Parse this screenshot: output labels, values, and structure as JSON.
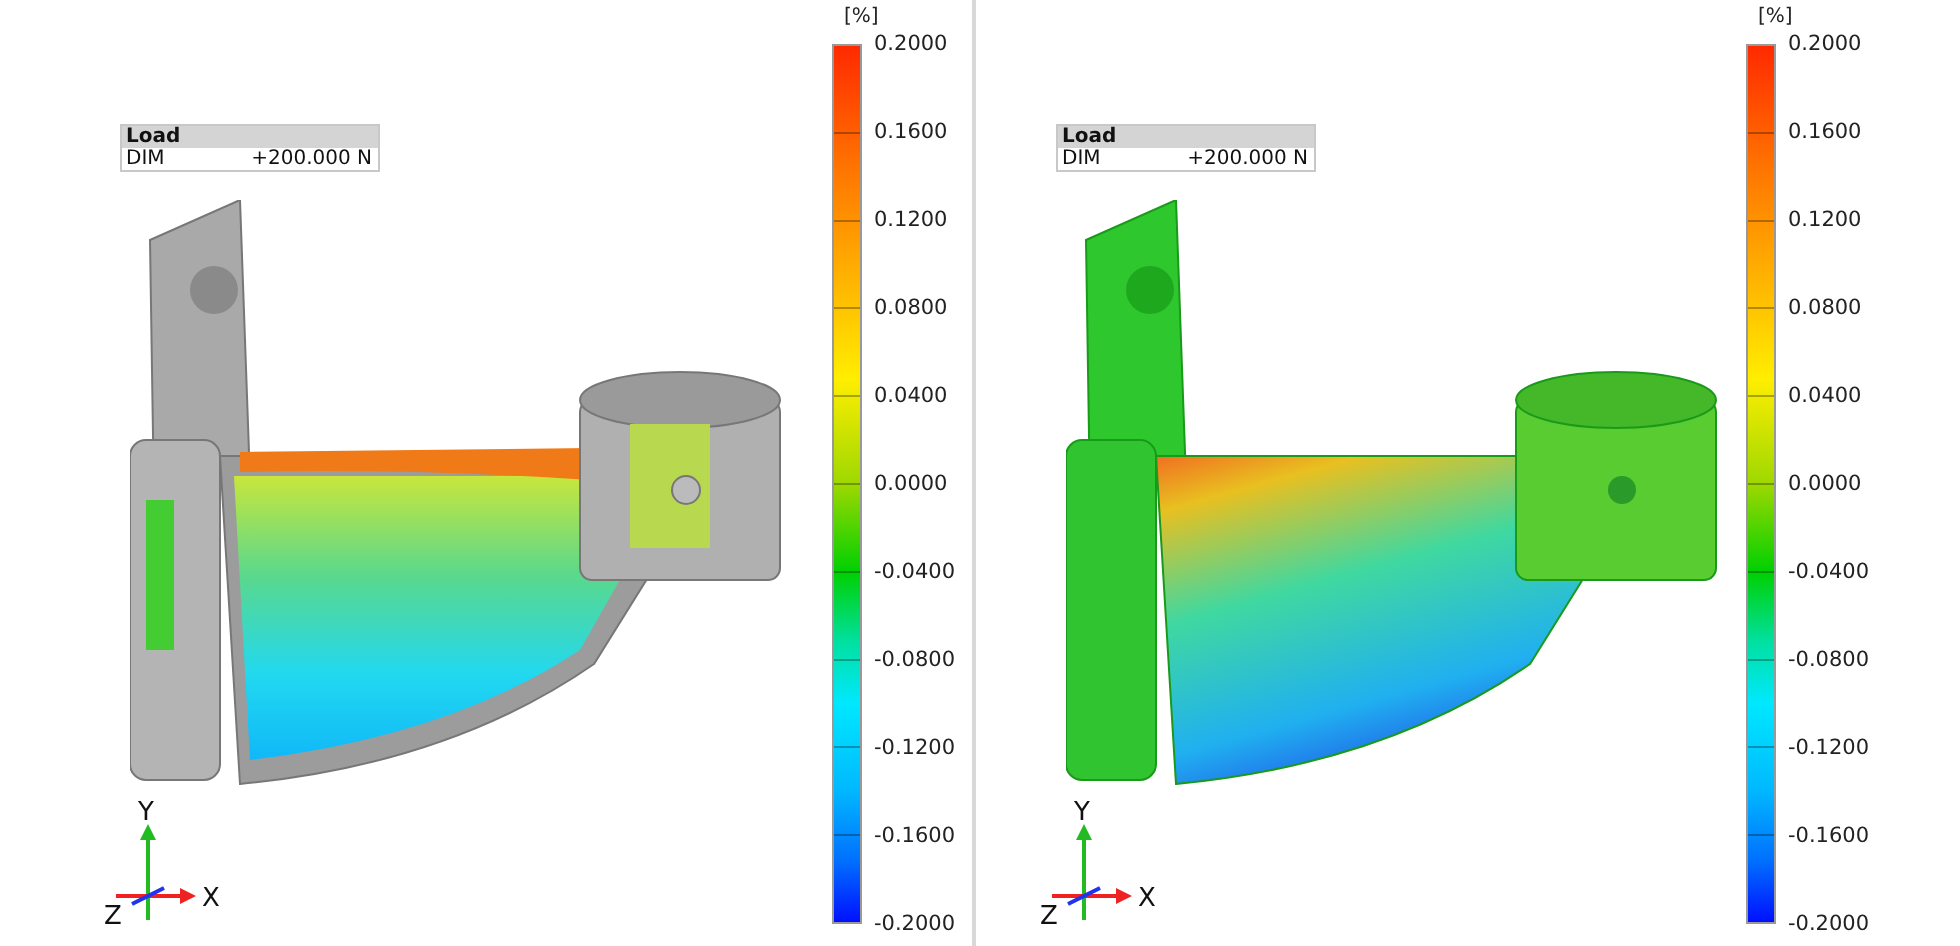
{
  "panels": [
    {
      "view": {
        "kind": "section"
      },
      "load_table": {
        "title": "Load",
        "rows": [
          {
            "label": "DIM",
            "value": "+200.000 N"
          }
        ]
      },
      "color_scale": {
        "unit": "[%]",
        "ticks": [
          "0.2000",
          "0.1600",
          "0.1200",
          "0.0800",
          "0.0400",
          "0.0000",
          "-0.0400",
          "-0.0800",
          "-0.1200",
          "-0.1600",
          "-0.2000"
        ]
      },
      "axes": {
        "y": "Y",
        "z": "Z",
        "x": "X"
      }
    },
    {
      "view": {
        "kind": "surface"
      },
      "load_table": {
        "title": "Load",
        "rows": [
          {
            "label": "DIM",
            "value": "+200.000 N"
          }
        ]
      },
      "color_scale": {
        "unit": "[%]",
        "ticks": [
          "0.2000",
          "0.1600",
          "0.1200",
          "0.0800",
          "0.0400",
          "0.0000",
          "-0.0400",
          "-0.0800",
          "-0.1200",
          "-0.1600",
          "-0.2000"
        ]
      },
      "axes": {
        "y": "Y",
        "z": "Z",
        "x": "X"
      }
    }
  ]
}
